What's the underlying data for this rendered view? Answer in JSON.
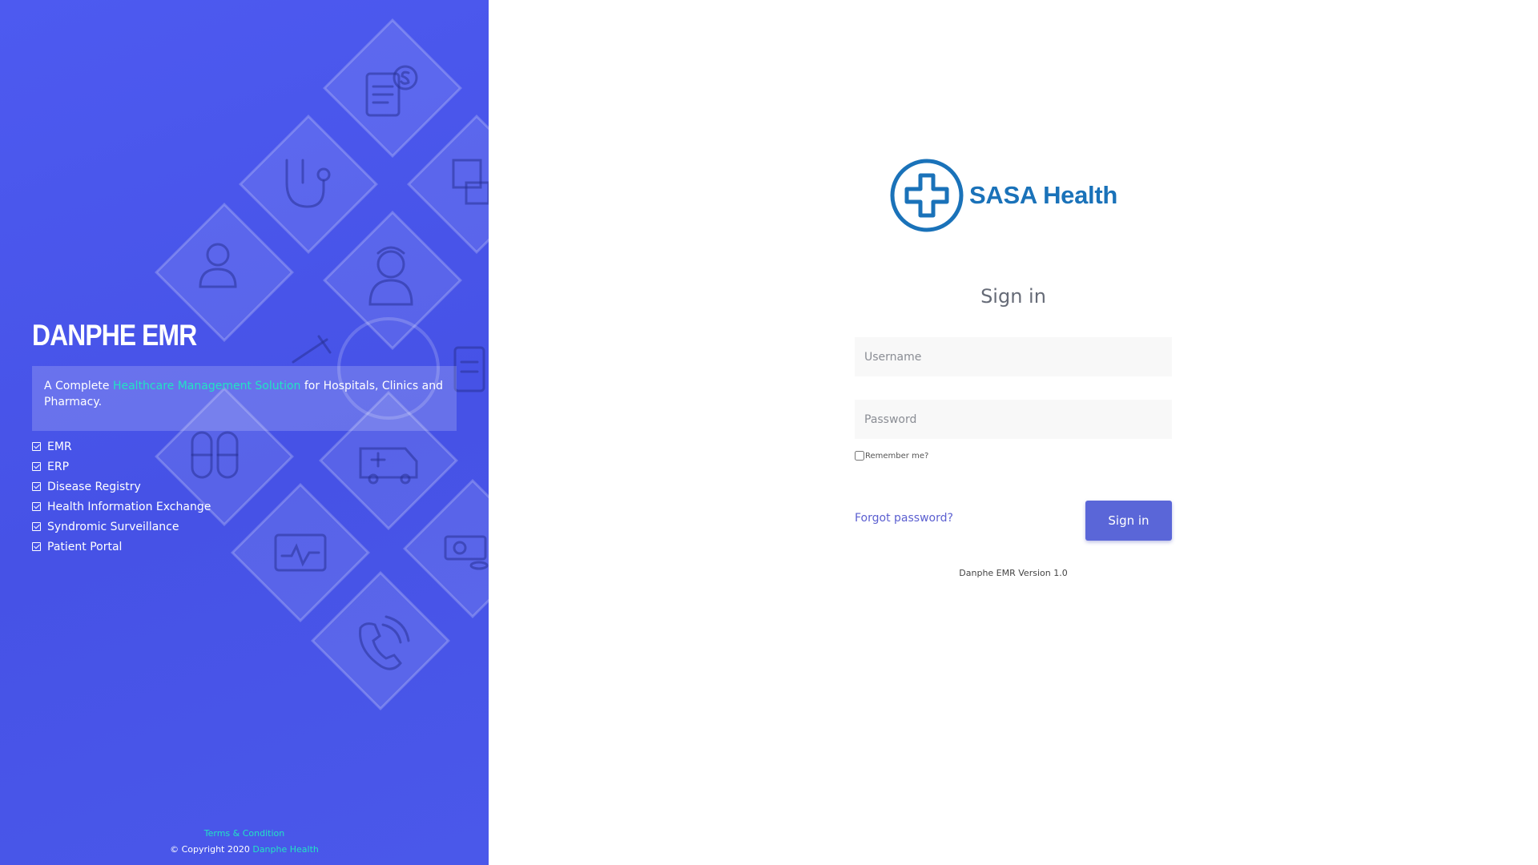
{
  "left_panel": {
    "brand_title": "DANPHE EMR",
    "tagline": {
      "prefix": "A Complete ",
      "highlight": "Healthcare Management Solution",
      "suffix": " for Hospitals, Clinics and Pharmacy."
    },
    "features": [
      "EMR",
      "ERP",
      "Disease Registry",
      "Health Information Exchange",
      "Syndromic Surveillance",
      "Patient Portal"
    ],
    "footer": {
      "terms": "Terms & Condition",
      "copyright": "© Copyright 2020 ",
      "company": "Danphe Health"
    }
  },
  "login": {
    "logo_text": "SASA Health",
    "heading": "Sign in",
    "username_placeholder": "Username",
    "password_placeholder": "Password",
    "remember_label": "Remember me?",
    "forgot_label": "Forgot password?",
    "signin_label": "Sign in",
    "version": "Danphe EMR Version 1.0"
  },
  "colors": {
    "panel": "#4a56ea",
    "accent": "#22e3c3",
    "button": "#5a66d8",
    "logo": "#1a72b9"
  }
}
